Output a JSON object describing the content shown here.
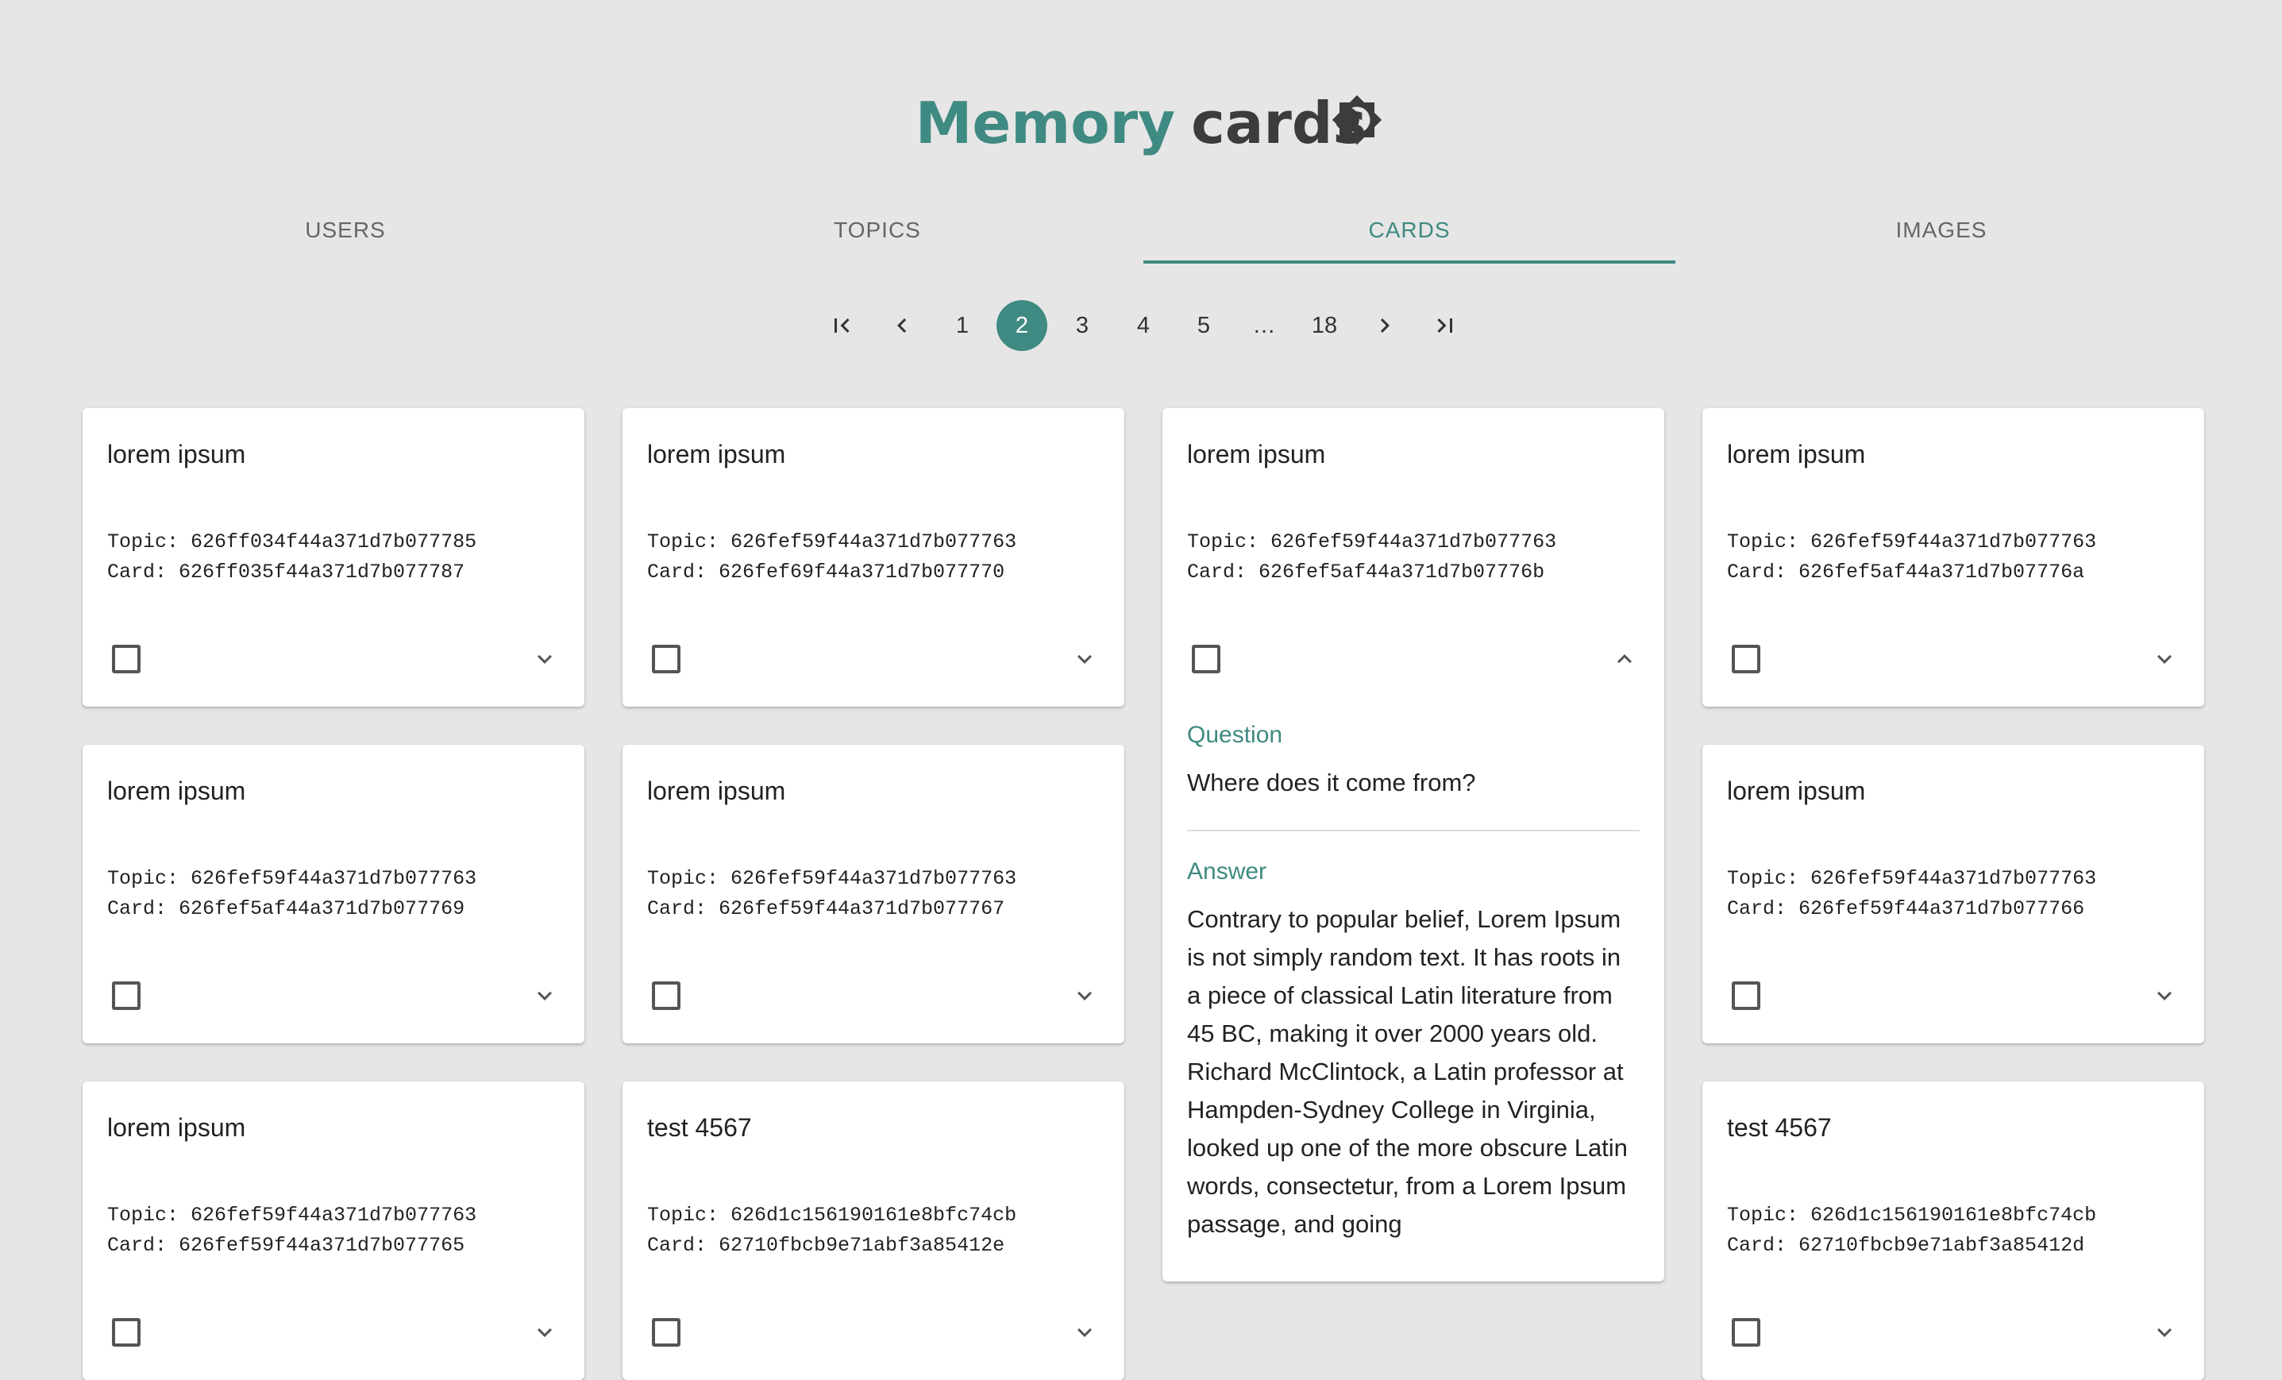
{
  "header": {
    "title_accent": "Memory",
    "title_rest": "cards",
    "theme_toggle_icon": "brightness-icon",
    "accent_color": "#3f8a82"
  },
  "tabs": [
    {
      "label": "USERS",
      "active": false
    },
    {
      "label": "TOPICS",
      "active": false
    },
    {
      "label": "CARDS",
      "active": true
    },
    {
      "label": "IMAGES",
      "active": false
    }
  ],
  "pagination": {
    "current": "2",
    "pages": [
      "1",
      "2",
      "3",
      "4",
      "5",
      "…",
      "18"
    ]
  },
  "cards": [
    {
      "title": "lorem ipsum",
      "topic": "Topic: 626ff034f44a371d7b077785",
      "card": "Card: 626ff035f44a371d7b077787",
      "expanded": false
    },
    {
      "title": "lorem ipsum",
      "topic": "Topic: 626fef59f44a371d7b077763",
      "card": "Card: 626fef69f44a371d7b077770",
      "expanded": false
    },
    {
      "title": "lorem ipsum",
      "topic": "Topic: 626fef59f44a371d7b077763",
      "card": "Card: 626fef5af44a371d7b07776b",
      "expanded": true,
      "question_label": "Question",
      "question": "Where does it come from?",
      "answer_label": "Answer",
      "answer": "Contrary to popular belief, Lorem Ipsum is not simply random text. It has roots in a piece of classical Latin literature from 45 BC, making it over 2000 years old. Richard McClintock, a Latin professor at Hampden-Sydney College in Virginia, looked up one of the more obscure Latin words, consectetur, from a Lorem Ipsum passage, and going"
    },
    {
      "title": "lorem ipsum",
      "topic": "Topic: 626fef59f44a371d7b077763",
      "card": "Card: 626fef5af44a371d7b07776a",
      "expanded": false
    },
    {
      "title": "lorem ipsum",
      "topic": "Topic: 626fef59f44a371d7b077763",
      "card": "Card: 626fef5af44a371d7b077769",
      "expanded": false
    },
    {
      "title": "lorem ipsum",
      "topic": "Topic: 626fef59f44a371d7b077763",
      "card": "Card: 626fef59f44a371d7b077767",
      "expanded": false
    },
    {
      "title": "lorem ipsum",
      "topic": "Topic: 626fef59f44a371d7b077763",
      "card": "Card: 626fef59f44a371d7b077766",
      "expanded": false
    },
    {
      "title": "lorem ipsum",
      "topic": "Topic: 626fef59f44a371d7b077763",
      "card": "Card: 626fef59f44a371d7b077765",
      "expanded": false
    },
    {
      "title": "test 4567",
      "topic": "Topic: 626d1c156190161e8bfc74cb",
      "card": "Card: 62710fbcb9e71abf3a85412e",
      "expanded": false
    },
    {
      "title": "test 4567",
      "topic": "Topic: 626d1c156190161e8bfc74cb",
      "card": "Card: 62710fbcb9e71abf3a85412d",
      "expanded": false
    }
  ]
}
